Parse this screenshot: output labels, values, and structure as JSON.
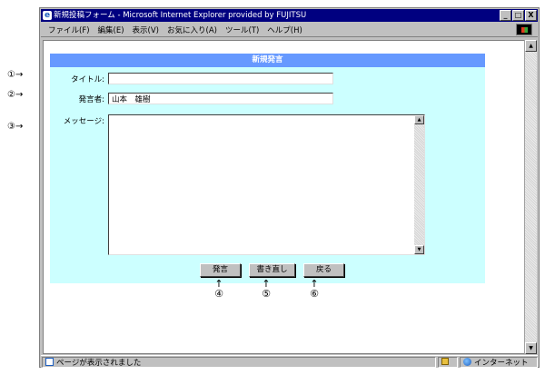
{
  "window": {
    "title": "新規投稿フォーム - Microsoft Internet Explorer provided by FUJITSU",
    "buttons": {
      "minimize": "_",
      "maximize": "□",
      "close": "X"
    }
  },
  "menu": [
    "ファイル(F)",
    "編集(E)",
    "表示(V)",
    "お気に入り(A)",
    "ツール(T)",
    "ヘルプ(H)"
  ],
  "form": {
    "header": "新規発言",
    "title_label": "タイトル:",
    "title_value": "",
    "speaker_label": "発言者:",
    "speaker_value": "山本　雄樹",
    "message_label": "メッセージ:",
    "message_value": "",
    "submit_label": "発言",
    "reset_label": "書き直し",
    "back_label": "戻る"
  },
  "callouts": {
    "c1": "①→",
    "c2": "②→",
    "c3": "③→",
    "up_arrow": "↑",
    "c4": "④",
    "c5": "⑤",
    "c6": "⑥"
  },
  "status": {
    "text": "ページが表示されました",
    "zone": "インターネット"
  },
  "icons": [
    "ie-icon",
    "windows-logo-icon",
    "page-icon",
    "lock-icon",
    "globe-icon",
    "scroll-up-icon",
    "scroll-down-icon"
  ],
  "colors": {
    "titlebar": "#000080",
    "form_header": "#6699ff",
    "form_bg": "#ccffff",
    "chrome": "#c0c0c0"
  }
}
